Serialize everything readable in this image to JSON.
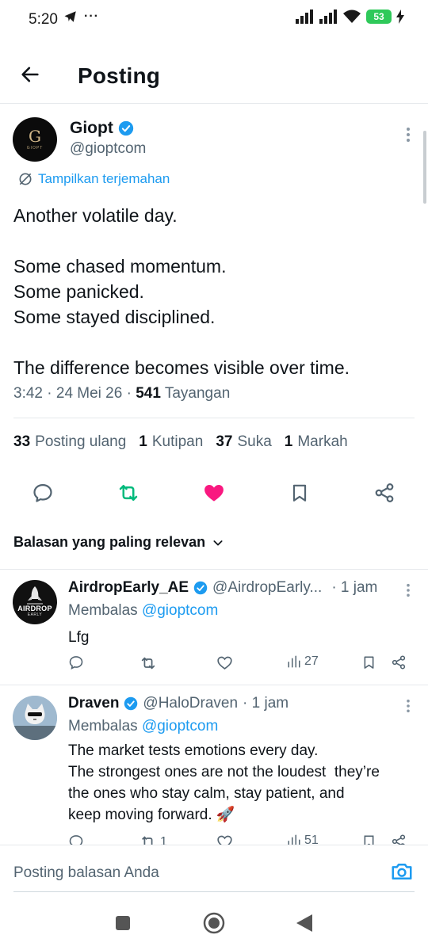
{
  "status_bar": {
    "time": "5:20",
    "battery": "53",
    "ellipsis": "···"
  },
  "header": {
    "title": "Posting"
  },
  "tweet": {
    "name": "Giopt",
    "handle": "@gioptcom",
    "avatar_letter": "G",
    "avatar_sub": "GIOPT",
    "translate_label": "Tampilkan terjemahan",
    "lines": [
      "Another volatile day.",
      "",
      "Some chased momentum.",
      "Some panicked.",
      "Some stayed disciplined.",
      "",
      "The difference becomes visible over time."
    ],
    "time": "3:42",
    "date": "24 Mei 26",
    "views_count": "541",
    "views_label": "Tayangan",
    "stats": [
      {
        "count": "33",
        "label": "Posting ulang"
      },
      {
        "count": "1",
        "label": "Kutipan"
      },
      {
        "count": "37",
        "label": "Suka"
      },
      {
        "count": "1",
        "label": "Markah"
      }
    ],
    "colors": {
      "retweet": "#00ba7c",
      "like": "#f91880",
      "link": "#1d9bf0"
    }
  },
  "sort_label": "Balasan yang paling relevan",
  "replies": [
    {
      "name": "AirdropEarly_AE",
      "handle": "@AirdropEarly...",
      "time": "· 1 jam",
      "replying_prefix": "Membalas",
      "replying_to": "@gioptcom",
      "avatar_text": "AIRDROP",
      "avatar_sub": "EARLY",
      "lines": [
        "Lfg"
      ],
      "views": "27",
      "retweets": "",
      "likes": ""
    },
    {
      "name": "Draven",
      "handle": "@HaloDraven",
      "time": "· 1 jam",
      "replying_prefix": "Membalas",
      "replying_to": "@gioptcom",
      "lines": [
        "The market tests emotions every day.",
        "The strongest ones are not the loudest  they’re",
        "the ones who stay calm, stay patient, and",
        "keep moving forward. 🚀"
      ],
      "views": "51",
      "retweets": "1",
      "likes": ""
    }
  ],
  "composer": {
    "placeholder": "Posting balasan Anda"
  }
}
